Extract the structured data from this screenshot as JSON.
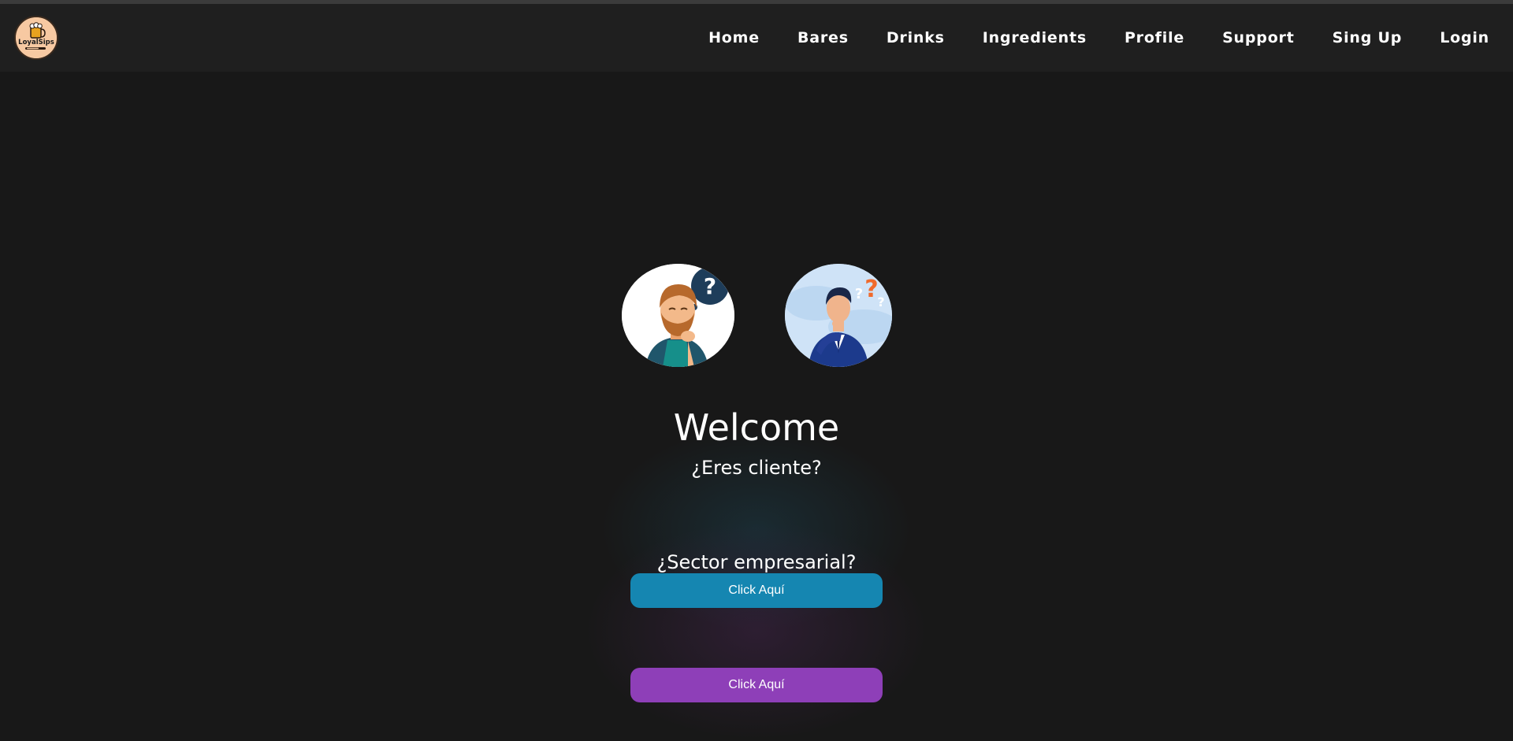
{
  "brand": {
    "logo_text": "LoyalSips",
    "logo_icon": "beer-mug-icon"
  },
  "nav": {
    "items": [
      {
        "label": "Home"
      },
      {
        "label": "Bares"
      },
      {
        "label": "Drinks"
      },
      {
        "label": "Ingredients"
      },
      {
        "label": "Profile"
      },
      {
        "label": "Support"
      },
      {
        "label": "Sing Up"
      },
      {
        "label": "Login"
      }
    ]
  },
  "hero": {
    "title": "Welcome",
    "client_question": "¿Eres cliente?",
    "client_button": "Click Aquí",
    "business_question": "¿Sector empresarial?",
    "business_button": "Click Aquí"
  },
  "images": {
    "client": "thinking-bearded-man-illustration",
    "business": "thinking-businessman-illustration"
  },
  "colors": {
    "background": "#181818",
    "navbar": "#1f1f1f",
    "client_button": "#1586b1",
    "business_button": "#8e3fb8",
    "logo_background": "#f7c9a2"
  }
}
